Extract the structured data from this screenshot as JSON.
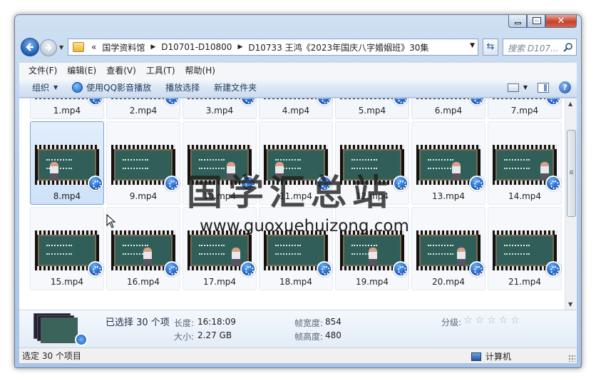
{
  "window": {
    "caption_buttons": {
      "minimize": "min-icon",
      "maximize": "max-icon",
      "close": "✕"
    }
  },
  "address": {
    "overflow": "«",
    "crumbs": [
      "国学资料馆",
      "D10701-D10800",
      "D10733 王鸿《2023年国庆八字婚姻班》30集"
    ],
    "search_placeholder": "搜索 D107..."
  },
  "menu": [
    "文件(F)",
    "编辑(E)",
    "查看(V)",
    "工具(T)",
    "帮助(H)"
  ],
  "toolbar": {
    "organize": "组织",
    "play_qq": "使用QQ影音播放",
    "play_selection": "播放选择",
    "new_folder": "新建文件夹"
  },
  "files": [
    {
      "name": "1.mp4"
    },
    {
      "name": "2.mp4"
    },
    {
      "name": "3.mp4"
    },
    {
      "name": "4.mp4"
    },
    {
      "name": "5.mp4"
    },
    {
      "name": "6.mp4"
    },
    {
      "name": "7.mp4"
    },
    {
      "name": "8.mp4"
    },
    {
      "name": "9.mp4"
    },
    {
      "name": "10.mp4"
    },
    {
      "name": "11.mp4"
    },
    {
      "name": "12.mp4"
    },
    {
      "name": "13.mp4"
    },
    {
      "name": "14.mp4"
    },
    {
      "name": "15.mp4"
    },
    {
      "name": "16.mp4"
    },
    {
      "name": "17.mp4"
    },
    {
      "name": "18.mp4"
    },
    {
      "name": "19.mp4"
    },
    {
      "name": "20.mp4"
    },
    {
      "name": "21.mp4"
    }
  ],
  "watermark": {
    "cn": "国学汇总站",
    "url": "www.guoxuehuizong.com"
  },
  "details": {
    "selected": "已选择 30 个项",
    "length_label": "长度:",
    "length": "16:18:09",
    "size_label": "大小:",
    "size": "2.27 GB",
    "width_label": "帧宽度:",
    "width": "854",
    "height_label": "帧高度:",
    "height": "480",
    "rating_label": "分级:",
    "rating_stars": "☆☆☆☆☆"
  },
  "status": {
    "left": "选定 30 个项目",
    "right": "计算机"
  },
  "colors": {
    "selection": "#cde2f9",
    "chrome": "#b9d0ec",
    "accent": "#1350b4"
  }
}
